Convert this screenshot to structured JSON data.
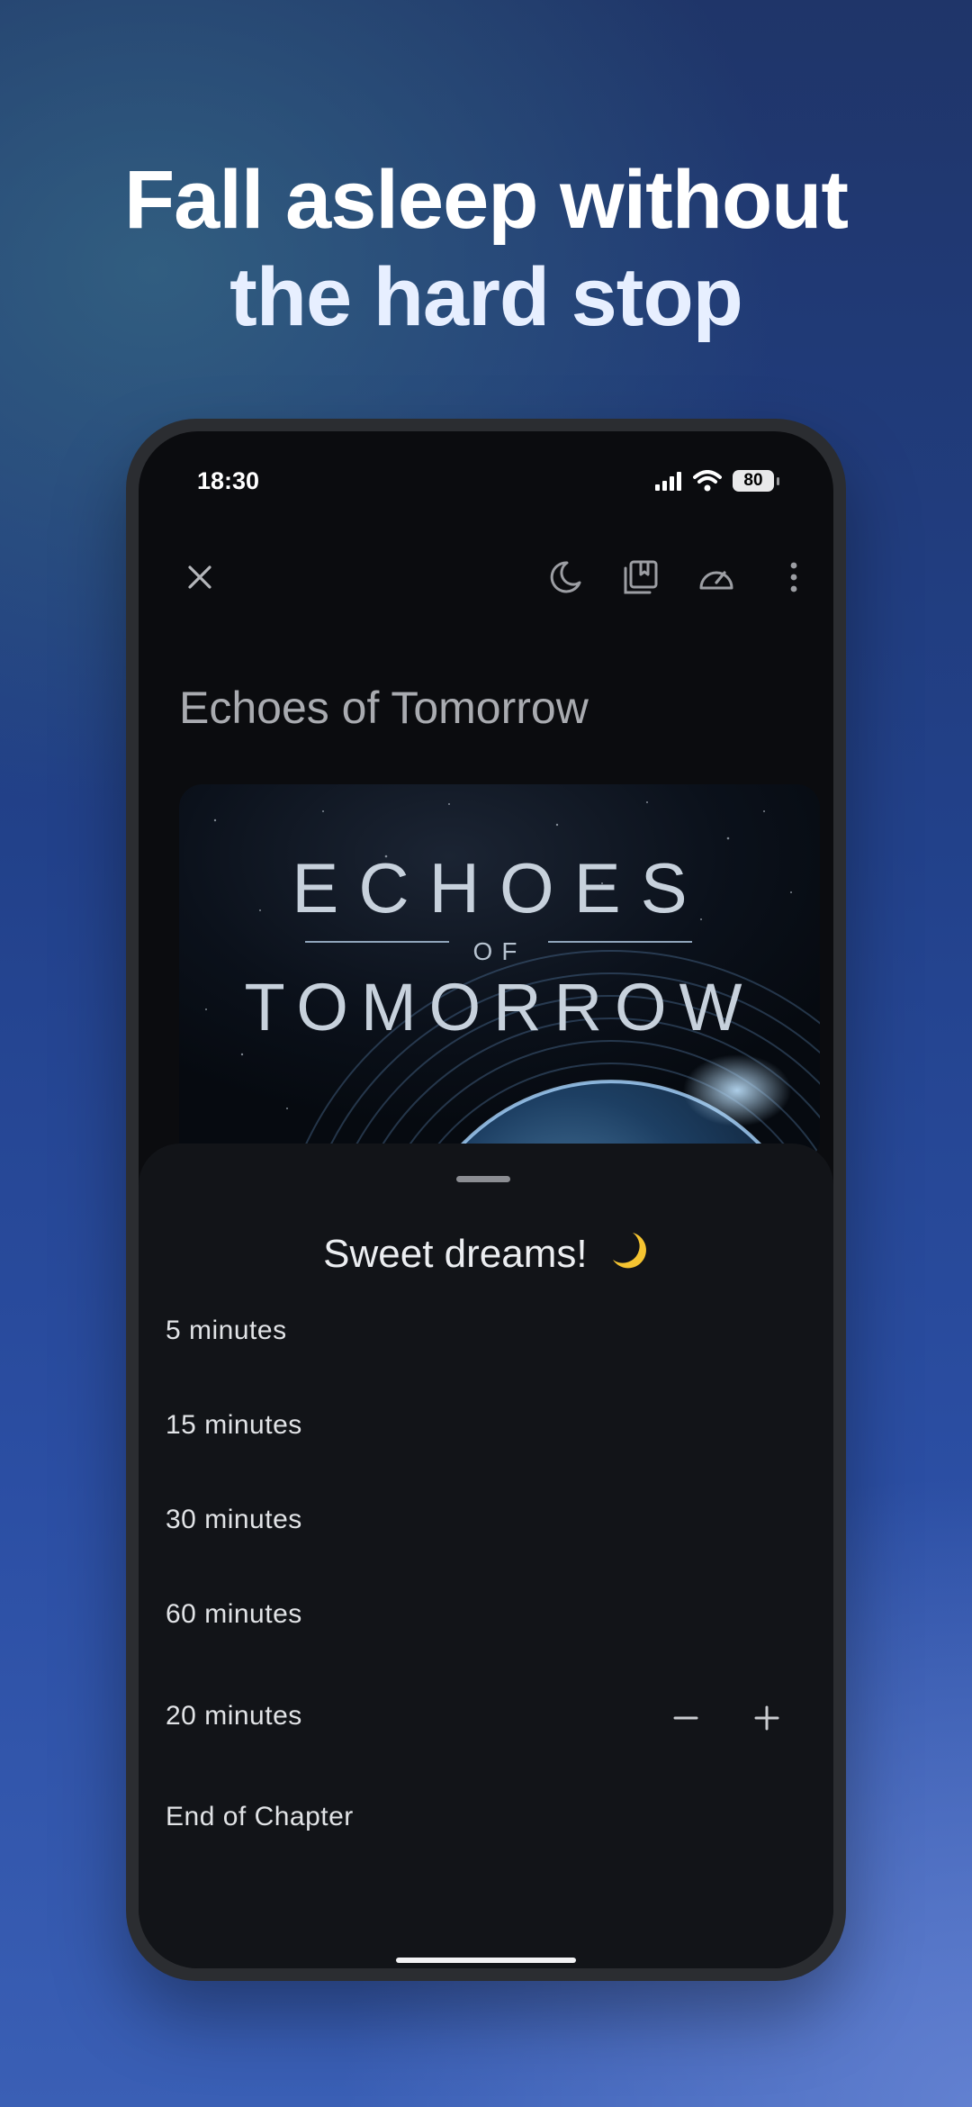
{
  "headline": {
    "line1": "Fall asleep without",
    "line2": "the hard stop"
  },
  "status_bar": {
    "time": "18:30",
    "battery_level": "80"
  },
  "toolbar": {
    "icons": [
      "close-icon",
      "moon-icon",
      "bookmarks-icon",
      "speed-icon",
      "more-vertical-icon"
    ]
  },
  "book": {
    "title": "Echoes of Tomorrow",
    "cover": {
      "line1": "ECHOES",
      "line_of": "OF",
      "line2": "TOMORROW"
    }
  },
  "sleep_timer_sheet": {
    "title": "Sweet dreams!",
    "title_emoji": "moon-icon",
    "options": [
      {
        "label": "5 minutes"
      },
      {
        "label": "15 minutes"
      },
      {
        "label": "30 minutes"
      },
      {
        "label": "60 minutes"
      }
    ],
    "custom": {
      "label": "20 minutes",
      "decrease_icon": "minus-icon",
      "increase_icon": "plus-icon"
    },
    "end_of_chapter": {
      "label": "End of Chapter"
    }
  },
  "colors": {
    "sheet_background": "#121418",
    "screen_background": "#0b0c0f",
    "moon_emoji": "#f5c431"
  }
}
